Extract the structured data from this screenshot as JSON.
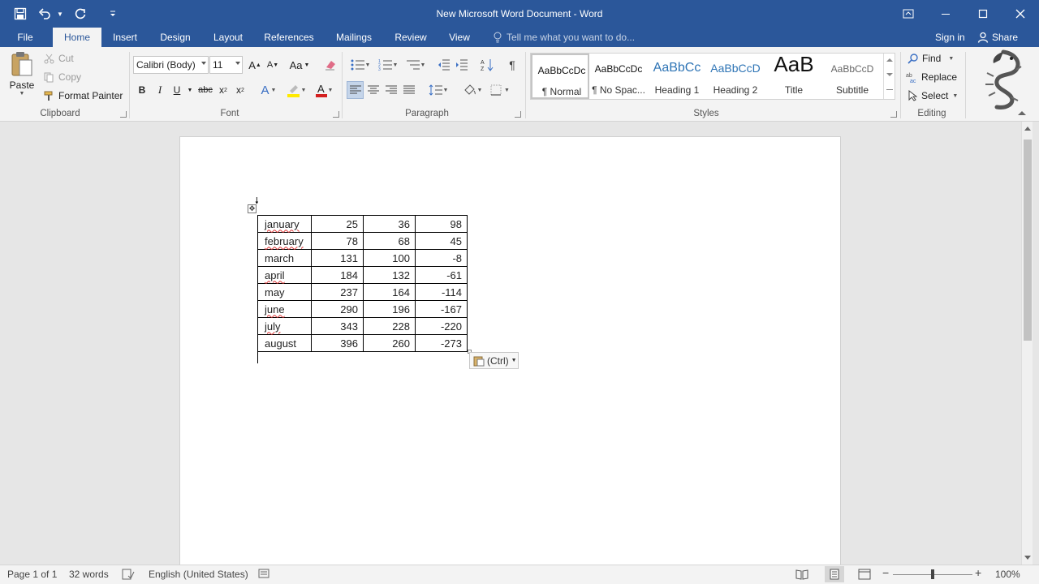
{
  "window": {
    "title": "New Microsoft Word Document - Word"
  },
  "tabs": {
    "file": "File",
    "home": "Home",
    "insert": "Insert",
    "design": "Design",
    "layout": "Layout",
    "references": "References",
    "mailings": "Mailings",
    "review": "Review",
    "view": "View",
    "tell_me": "Tell me what you want to do...",
    "sign_in": "Sign in",
    "share": "Share"
  },
  "ribbon": {
    "clipboard": {
      "paste": "Paste",
      "cut": "Cut",
      "copy": "Copy",
      "format_painter": "Format Painter",
      "label": "Clipboard"
    },
    "font": {
      "font_name": "Calibri (Body)",
      "font_size": "11",
      "label": "Font"
    },
    "paragraph": {
      "label": "Paragraph"
    },
    "styles": {
      "label": "Styles",
      "items": [
        {
          "preview": "AaBbCcDc",
          "name": "¶ Normal"
        },
        {
          "preview": "AaBbCcDc",
          "name": "¶ No Spac..."
        },
        {
          "preview": "AaBbCc",
          "name": "Heading 1"
        },
        {
          "preview": "AaBbCcD",
          "name": "Heading 2"
        },
        {
          "preview": "AaB",
          "name": "Title"
        },
        {
          "preview": "AaBbCcD",
          "name": "Subtitle"
        }
      ]
    },
    "editing": {
      "find": "Find",
      "replace": "Replace",
      "select": "Select",
      "label": "Editing"
    }
  },
  "document": {
    "table": [
      [
        "january",
        "25",
        "36",
        "98"
      ],
      [
        "february",
        "78",
        "68",
        "45"
      ],
      [
        "march",
        "131",
        "100",
        "-8"
      ],
      [
        "april",
        "184",
        "132",
        "-61"
      ],
      [
        "may",
        "237",
        "164",
        "-114"
      ],
      [
        "june",
        "290",
        "196",
        "-167"
      ],
      [
        "july",
        "343",
        "228",
        "-220"
      ],
      [
        "august",
        "396",
        "260",
        "-273"
      ]
    ],
    "paste_options": "(Ctrl)"
  },
  "status": {
    "page": "Page 1 of 1",
    "words": "32 words",
    "language": "English (United States)",
    "zoom": "100%"
  },
  "colors": {
    "accent": "#2b579a",
    "spell_error": "#d33333"
  }
}
